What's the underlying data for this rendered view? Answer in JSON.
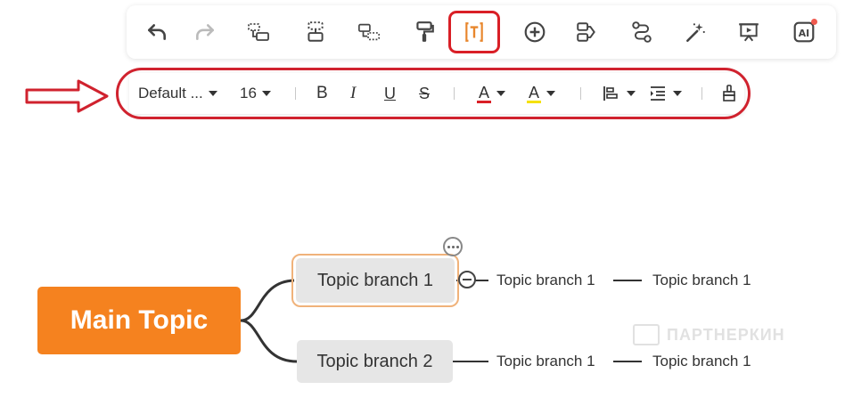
{
  "format_bar": {
    "font_family": "Default ...",
    "font_size": "16",
    "bold": "B",
    "italic": "I",
    "underline": "U",
    "strike": "S",
    "font_color_letter": "A",
    "highlight_letter": "A",
    "font_color": "#d91f26",
    "highlight_color": "#f5e100"
  },
  "toolbar_icons": [
    "undo-icon",
    "redo-icon",
    "insert-subtopic-icon",
    "insert-topic-icon",
    "insert-floating-topic-icon",
    "format-painter-icon",
    "text-frame-icon",
    "add-icon",
    "relationship-icon",
    "connector-icon",
    "magic-wand-icon",
    "presentation-icon",
    "ai-icon"
  ],
  "ai_label": "AI",
  "mindmap": {
    "main_topic": "Main Topic",
    "branches": [
      {
        "label": "Topic branch 1",
        "subtopics": [
          "Topic branch 1",
          "Topic branch 1"
        ]
      },
      {
        "label": "Topic branch 2",
        "subtopics": [
          "Topic branch 1",
          "Topic branch 1"
        ]
      }
    ]
  },
  "watermark": "ПАРТНЕРКИН",
  "accent_color": "#f5821f",
  "highlight_red": "#d0222e"
}
